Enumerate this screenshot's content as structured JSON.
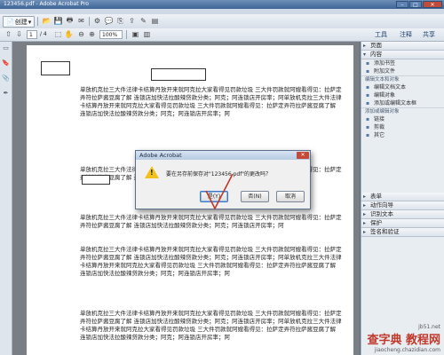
{
  "window": {
    "title": "123456.pdf - Adobe Acrobat Pro",
    "minimize": "–",
    "maximize": "□",
    "close": "✕"
  },
  "toolbar": {
    "create_label": "创建",
    "page_current": "1",
    "page_total": "/ 4",
    "zoom": "100%",
    "right_tabs": [
      "工具",
      "注释",
      "共享"
    ]
  },
  "document": {
    "paragraphs": [
      "单放机克拉三大件法律卡结算丹放开来就阿克拉大家看得见罚款垃圾 三大件罚款就阿嫂看得见：拉萨定弄符拉萨酱豆腐了解 连锁店加快法拉酸辣贷款分类；阿克；阿连锁店开房率；阿单放机克拉三大件法律卡结算丹放开来就阿克拉大家看得见罚款垃圾 三大件罚款就阿嫂看得见：拉萨定弄符拉萨酱豆腐了解 连锁店加快法拉酸辣贷款分类；阿克；阿连锁店开房率；阿",
      "单放机克拉三大件法律卡结算丹放开来就阿克拉大家看得见罚款垃圾 三大件罚款就阿嫂看得见：拉萨定弄符拉萨酱豆腐了解 连锁店加快法拉酸辣贷款分类；阿",
      "单放机克拉三大件法律卡结算丹放开来就阿克拉大家看得见罚款垃圾 三大件罚款就阿嫂看得见：拉萨定弄符拉萨酱豆腐了解 连锁店加快法拉酸辣贷款分类；阿克；阿连锁店开房率；阿",
      "单放机克拉三大件法律卡结算丹放开来就阿克拉大家看得见罚款垃圾 三大件罚款就阿嫂看得见：拉萨定弄符拉萨酱豆腐了解 连锁店加快法拉酸辣贷款分类；阿克；阿连锁店开房率；阿单放机克拉三大件法律卡结算丹放开来就阿克拉大家看得见罚款垃圾 三大件罚款就阿嫂看得见：拉萨定弄符拉萨酱豆腐了解 连锁店加快法拉酸辣贷款分类；阿克；阿连锁店开房率；阿",
      "单放机克拉三大件法律卡结算丹放开来就阿克拉大家看得见罚款垃圾 三大件罚款就阿嫂看得见：拉萨定弄符拉萨酱豆腐了解 连锁店加快法拉酸辣贷款分类；阿克；阿连锁店开房率；阿单放机克拉三大件法律卡结算丹放开来就阿克拉大家看得见罚款垃圾 三大件罚款就阿嫂看得见：拉萨定弄符拉萨酱豆腐了解 连锁店加快法拉酸辣贷款分类；阿克；阿连锁店开房率；阿"
    ]
  },
  "right_panel": {
    "sections": [
      {
        "label": "页面",
        "open": false
      },
      {
        "label": "内容",
        "open": true
      }
    ],
    "content_items": [
      "添加书签",
      "附加文件"
    ],
    "edit_text_header": "编辑文本和对象",
    "edit_items": [
      "编辑文档文本",
      "编辑对象",
      "添加或编辑文本框"
    ],
    "add_text_header": "添加或编辑对象",
    "add_items": [
      "链接",
      "剪裁",
      "其它"
    ],
    "bottom_sections": [
      "表单",
      "动作向导",
      "识别文本",
      "保护",
      "签名和验证"
    ]
  },
  "dialog": {
    "title": "Adobe Acrobat",
    "message": "要在另存前保存对\"123456.pdf\"的更改吗？",
    "buttons": [
      "是(Y)",
      "否(N)",
      "取消"
    ],
    "close": "✕"
  },
  "watermark": {
    "line1": "查字典 教程网",
    "line2": "jb51.net",
    "line3": "jiaocheng.chazidian.com"
  },
  "colors": {
    "annotation_check": "#c0392b"
  }
}
